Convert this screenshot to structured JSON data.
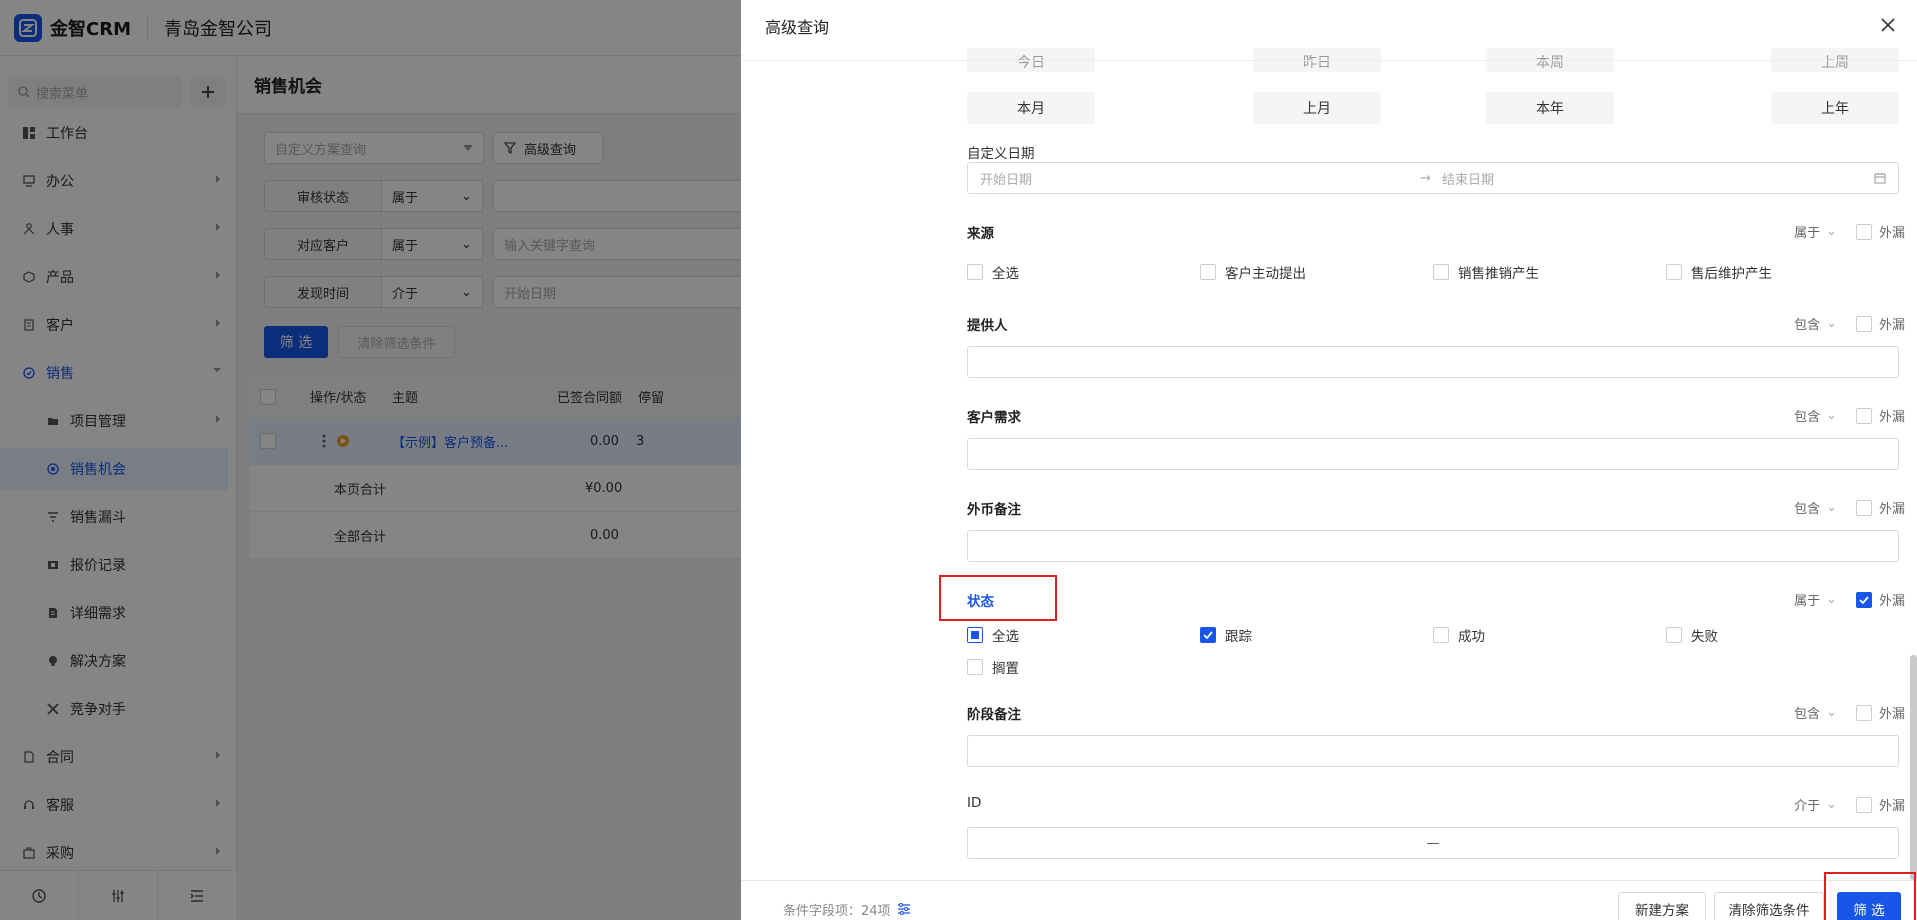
{
  "header": {
    "brand": "金智CRM",
    "company": "青岛金智公司"
  },
  "sidebar": {
    "search_placeholder": "搜索菜单",
    "items": [
      {
        "label": "工作台",
        "icon": "dashboard-icon"
      },
      {
        "label": "办公",
        "icon": "monitor-icon"
      },
      {
        "label": "人事",
        "icon": "org-icon"
      },
      {
        "label": "产品",
        "icon": "cube-icon"
      },
      {
        "label": "客户",
        "icon": "building-icon"
      },
      {
        "label": "销售",
        "icon": "sales-icon"
      },
      {
        "label": "项目管理",
        "icon": "folder-icon"
      },
      {
        "label": "销售机会",
        "icon": "target-icon"
      },
      {
        "label": "销售漏斗",
        "icon": "funnel-icon"
      },
      {
        "label": "报价记录",
        "icon": "quote-icon"
      },
      {
        "label": "详细需求",
        "icon": "document-icon"
      },
      {
        "label": "解决方案",
        "icon": "bulb-icon"
      },
      {
        "label": "竞争对手",
        "icon": "cross-swords-icon"
      },
      {
        "label": "合同",
        "icon": "contract-icon"
      },
      {
        "label": "客服",
        "icon": "headset-icon"
      },
      {
        "label": "采购",
        "icon": "cart-icon"
      }
    ]
  },
  "main": {
    "page_title": "销售机会",
    "scheme_placeholder": "自定义方案查询",
    "advanced_btn": "高级查询",
    "filters": [
      {
        "label": "审核状态",
        "op": "属于",
        "placeholder": ""
      },
      {
        "label": "对应客户",
        "op": "属于",
        "placeholder": "输入关键字查询"
      },
      {
        "label": "发现时间",
        "op": "介于",
        "placeholder": "开始日期"
      }
    ],
    "filter_btn": "筛 选",
    "clear_btn": "清除筛选条件",
    "table": {
      "columns": [
        "操作/状态",
        "主题",
        "已签合同额",
        "停留"
      ],
      "row": {
        "subject": "【示例】客户预备...",
        "amount": "0.00",
        "days": "3"
      },
      "page_total_label": "本页合计",
      "page_total_value": "¥0.00",
      "all_total_label": "全部合计",
      "all_total_value": "0.00"
    }
  },
  "drawer": {
    "title": "高级查询",
    "date_row_cut": [
      "今日",
      "昨日",
      "本周",
      "上周"
    ],
    "date_row": [
      "本月",
      "上月",
      "本年",
      "上年"
    ],
    "custom_date_label": "自定义日期",
    "start_date_placeholder": "开始日期",
    "end_date_placeholder": "结束日期",
    "exclude_label": "外漏",
    "source": {
      "label": "来源",
      "op": "属于",
      "options": [
        "全选",
        "客户主动提出",
        "销售推销产生",
        "售后维护产生"
      ]
    },
    "provider": {
      "label": "提供人",
      "op": "包含"
    },
    "need": {
      "label": "客户需求",
      "op": "包含"
    },
    "currency_note": {
      "label": "外币备注",
      "op": "包含"
    },
    "status": {
      "label": "状态",
      "op": "属于",
      "options": [
        "全选",
        "跟踪",
        "成功",
        "失败",
        "搁置"
      ]
    },
    "stage_note": {
      "label": "阶段备注",
      "op": "包含"
    },
    "id_field": {
      "label": "ID",
      "op": "介于",
      "separator": "—"
    },
    "footer": {
      "count_label": "条件字段项：24项",
      "new_scheme": "新建方案",
      "clear": "清除筛选条件",
      "filter": "筛 选"
    }
  }
}
